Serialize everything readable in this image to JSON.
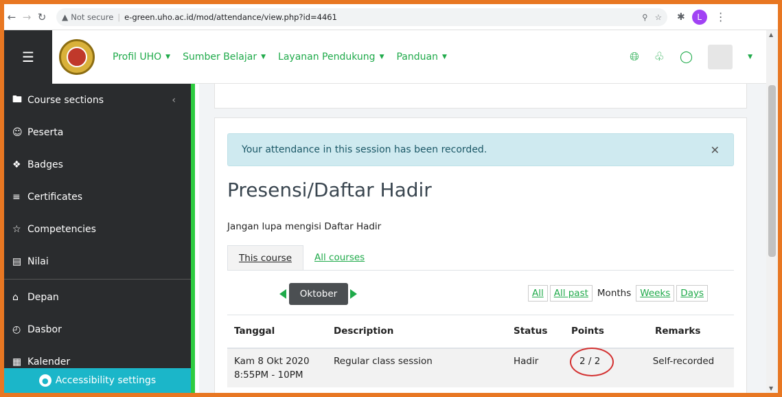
{
  "browser": {
    "not_secure": "Not secure",
    "url": "e-green.uho.ac.id/mod/attendance/view.php?id=4461",
    "profile_initial": "L"
  },
  "navbar": {
    "menu": [
      {
        "label": "Profil UHO"
      },
      {
        "label": "Sumber Belajar"
      },
      {
        "label": "Layanan Pendukung"
      },
      {
        "label": "Panduan"
      }
    ]
  },
  "sidebar": {
    "items": [
      {
        "label": "Course sections",
        "icon": "folder-icon"
      },
      {
        "label": "Peserta",
        "icon": "users-icon"
      },
      {
        "label": "Badges",
        "icon": "badge-icon"
      },
      {
        "label": "Certificates",
        "icon": "certificate-icon"
      },
      {
        "label": "Competencies",
        "icon": "star-icon"
      },
      {
        "label": "Nilai",
        "icon": "grades-icon"
      },
      {
        "label": "Depan",
        "icon": "home-icon"
      },
      {
        "label": "Dasbor",
        "icon": "dashboard-icon"
      },
      {
        "label": "Kalender",
        "icon": "calendar-icon"
      }
    ],
    "accessibility": "Accessibility settings"
  },
  "main": {
    "alert": "Your attendance in this session has been recorded.",
    "title": "Presensi/Daftar Hadir",
    "intro": "Jangan lupa mengisi Daftar Hadir",
    "tabs": [
      {
        "label": "This course"
      },
      {
        "label": "All courses"
      }
    ],
    "month": "Oktober",
    "periods": [
      {
        "label": "All"
      },
      {
        "label": "All past"
      },
      {
        "label": "Months"
      },
      {
        "label": "Weeks"
      },
      {
        "label": "Days"
      }
    ],
    "table": {
      "headers": [
        "Tanggal",
        "Description",
        "Status",
        "Points",
        "Remarks"
      ],
      "rows": [
        {
          "date_line1": "Kam 8 Okt 2020",
          "date_line2": "8:55PM - 10PM",
          "description": "Regular class session",
          "status": "Hadir",
          "points": "2 / 2",
          "remarks": "Self-recorded"
        }
      ]
    }
  },
  "colors": {
    "accent": "#1faa4a",
    "sidebar_bg": "#2a2c2e",
    "alert_bg": "#cfeaf0",
    "frame": "#e87722"
  }
}
